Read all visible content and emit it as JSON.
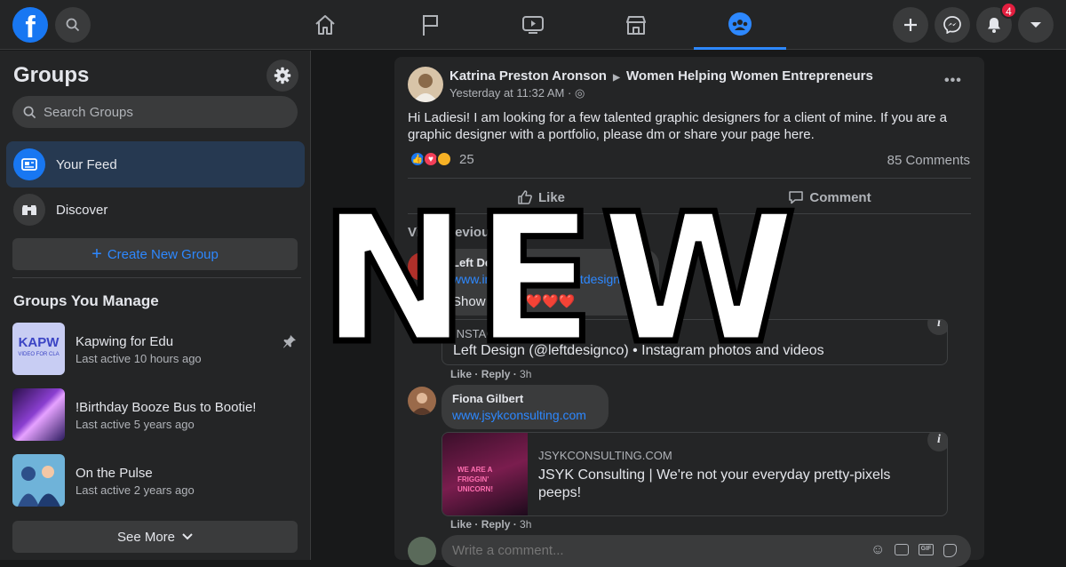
{
  "topbar": {
    "notification_count": "4"
  },
  "sidebar": {
    "title": "Groups",
    "search_placeholder": "Search Groups",
    "nav": [
      {
        "label": "Your Feed"
      },
      {
        "label": "Discover"
      }
    ],
    "create_label": "Create New Group",
    "section_title": "Groups You Manage",
    "groups": [
      {
        "name": "Kapwing for Edu",
        "last_active": "Last active 10 hours ago",
        "thumb_text": "KAPW",
        "thumb_sub": "VIDEO FOR CLA"
      },
      {
        "name": "!Birthday Booze Bus to Bootie!",
        "last_active": "Last active 5 years ago"
      },
      {
        "name": "On the Pulse",
        "last_active": "Last active 2 years ago"
      }
    ],
    "see_more": "See More"
  },
  "post": {
    "author": "Katrina Preston Aronson",
    "group": "Women Helping Women Entrepreneurs",
    "time": "Yesterday at 11:32 AM",
    "dot": "·",
    "text": "Hi Ladiesi! I am looking for a few talented graphic designers for a client of mine. If you are a graphic designer with a portfolio, please dm or share your page here.",
    "reaction_count": "25",
    "comment_count": "85 Comments",
    "like_label": "Like",
    "comment_label": "Comment",
    "view_previous": "View previous comments",
    "comments": [
      {
        "name": "Left Design",
        "link": "www.instagram.com/leftdesignco",
        "text": "Show some ❤️❤️❤️",
        "card_source": "INSTAGRAM.COM",
        "card_title": "Left Design (@leftdesignco) • Instagram photos and videos",
        "like": "Like",
        "reply": "Reply",
        "time": "3h"
      },
      {
        "name": "Fiona Gilbert",
        "link": "www.jsykconsulting.com",
        "card_source": "JSYKCONSULTING.COM",
        "card_title": "JSYK Consulting | We're not your everyday pretty-pixels peeps!",
        "card_image_text": "WE ARE A FRIGGIN' UNICORN!",
        "like": "Like",
        "reply": "Reply",
        "time": "3h"
      }
    ],
    "write_placeholder": "Write a comment..."
  },
  "overlay": {
    "text": "NEW"
  },
  "colors": {
    "accent": "#2d88ff",
    "brand": "#1877f2",
    "bg": "#18191a",
    "surface": "#242526"
  }
}
